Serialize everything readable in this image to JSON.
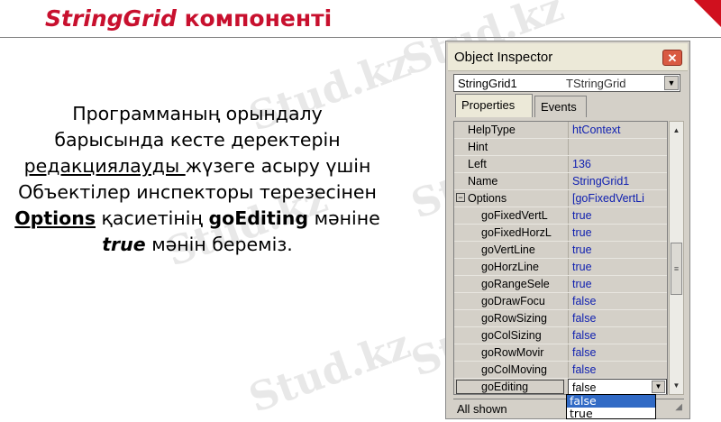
{
  "slide": {
    "title_italic": "StringGrid",
    "title_rest": " компоненті",
    "paragraph": {
      "line1": "Программаның орындалу",
      "line2": "барысында кесте деректерін",
      "line3_u": "редакциялауды ",
      "line3_rest": "жүзеге асыру үшін",
      "line4": "Объектілер инспекторы терезесінен",
      "line5_b": "Options",
      "line5_mid": " қасиетінің  ",
      "line5_b2": "goEditing",
      "line5_end": " мәніне",
      "line6_bi": "true",
      "line6_end": " мәнін береміз."
    }
  },
  "watermark": {
    "text": "Stud.kz"
  },
  "colors": {
    "title": "#c8102e",
    "value_text": "#1020b0",
    "selection": "#316ac5"
  },
  "object_inspector": {
    "title": "Object Inspector",
    "close_icon": "close-icon",
    "component": {
      "name": "StringGrid1",
      "type": "TStringGrid"
    },
    "tabs": [
      {
        "label": "Properties",
        "active": true
      },
      {
        "label": "Events",
        "active": false
      }
    ],
    "properties": [
      {
        "name": "HelpType",
        "value": "htContext"
      },
      {
        "name": "Hint",
        "value": ""
      },
      {
        "name": "Left",
        "value": "136"
      },
      {
        "name": "Name",
        "value": "StringGrid1"
      },
      {
        "name": "Options",
        "value": "[goFixedVertLi"
      },
      {
        "name": "goFixedVertL",
        "value": "true"
      },
      {
        "name": "goFixedHorzL",
        "value": "true"
      },
      {
        "name": "goVertLine",
        "value": "true"
      },
      {
        "name": "goHorzLine",
        "value": "true"
      },
      {
        "name": "goRangeSele",
        "value": "true"
      },
      {
        "name": "goDrawFocu",
        "value": "false"
      },
      {
        "name": "goRowSizing",
        "value": "false"
      },
      {
        "name": "goColSizing",
        "value": "false"
      },
      {
        "name": "goRowMovir",
        "value": "false"
      },
      {
        "name": "goColMoving",
        "value": "false"
      },
      {
        "name": "goEditing",
        "value": "false"
      }
    ],
    "options_expander": "⊟",
    "dropdown_options": [
      "false",
      "true"
    ],
    "dropdown_selected": "false",
    "status": "All shown"
  }
}
